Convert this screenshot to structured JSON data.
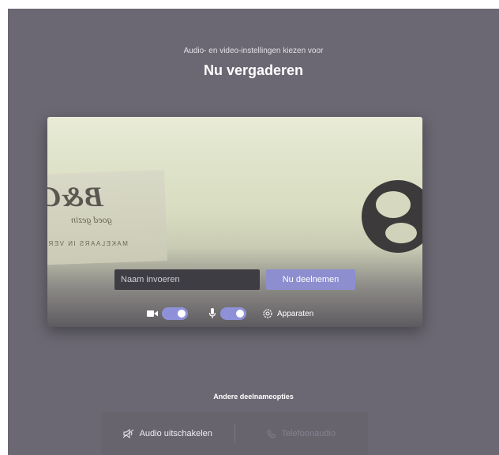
{
  "header": {
    "subtitle": "Audio- en video-instellingen kiezen voor",
    "title": "Nu vergaderen"
  },
  "preview": {
    "logo_text": "B&C",
    "slogan": "goed gezin",
    "tagline": "MAKELAARS IN VER"
  },
  "join": {
    "name_placeholder": "Naam invoeren",
    "join_button": "Nu deelnemen"
  },
  "controls": {
    "camera_icon": "video-camera-icon",
    "camera_on": true,
    "mic_icon": "microphone-icon",
    "mic_on": true,
    "devices_icon": "gear-icon",
    "devices_label": "Apparaten"
  },
  "other_options": {
    "title": "Andere deelnameopties",
    "audio_off_icon": "speaker-off-icon",
    "audio_off_label": "Audio uitschakelen",
    "phone_icon": "phone-icon",
    "phone_label": "Telefoonaudio"
  },
  "colors": {
    "background": "#6b6873",
    "accent": "#8c8ed0",
    "input_bg": "#3f3d44"
  }
}
